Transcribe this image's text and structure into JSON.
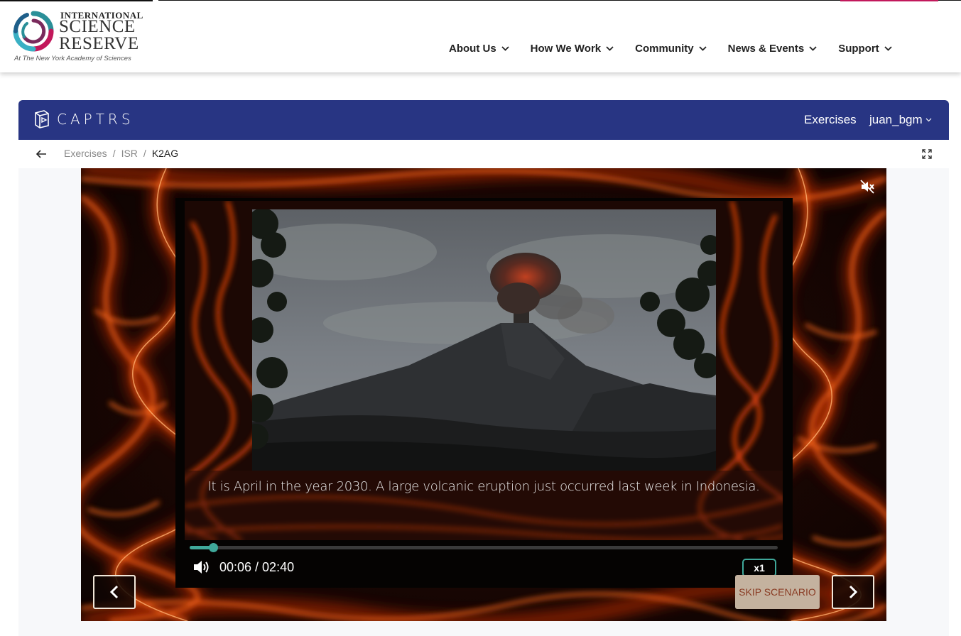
{
  "site_header": {
    "logo": {
      "line1": "INTERNATIONAL",
      "line2": "SCIENCE",
      "line3": "RESERVE",
      "tagline": "At The New York Academy of Sciences"
    },
    "nav": [
      {
        "label": "About Us",
        "icon": "chevron-down-icon"
      },
      {
        "label": "How We Work",
        "icon": "chevron-down-icon"
      },
      {
        "label": "Community",
        "icon": "chevron-down-icon"
      },
      {
        "label": "News & Events",
        "icon": "chevron-down-icon"
      },
      {
        "label": "Support",
        "icon": "chevron-down-icon"
      }
    ]
  },
  "app_bar": {
    "brand": "CAPTRS",
    "links": {
      "exercises": "Exercises",
      "user": "juan_bgm"
    },
    "color": "#283583"
  },
  "breadcrumb": {
    "items": [
      "Exercises",
      "ISR"
    ],
    "current": "K2AG"
  },
  "scenario": {
    "caption": "It is April in the year 2030. A large volcanic eruption just occurred last week in Indonesia.",
    "progress": 0.04,
    "time": "00:06 / 02:40",
    "speed": "x1",
    "skip_label": "SKIP SCENARIO",
    "accent": "#3fa89a"
  }
}
